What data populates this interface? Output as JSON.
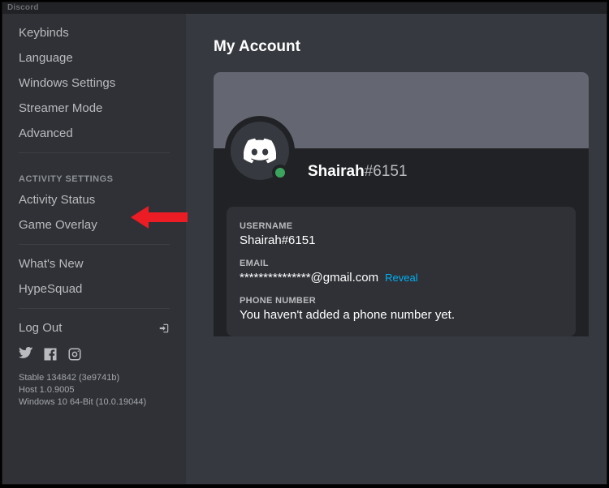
{
  "app": {
    "title": "Discord"
  },
  "sidebar": {
    "items": [
      {
        "label": "Keybinds"
      },
      {
        "label": "Language"
      },
      {
        "label": "Windows Settings"
      },
      {
        "label": "Streamer Mode"
      },
      {
        "label": "Advanced"
      }
    ],
    "activity_header": "ACTIVITY SETTINGS",
    "activity_items": [
      {
        "label": "Activity Status"
      },
      {
        "label": "Game Overlay"
      }
    ],
    "misc_items": [
      {
        "label": "What's New"
      },
      {
        "label": "HypeSquad"
      }
    ],
    "logout_label": "Log Out"
  },
  "build": {
    "line1": "Stable 134842 (3e9741b)",
    "line2": "Host 1.0.9005",
    "line3": "Windows 10 64-Bit (10.0.19044)"
  },
  "page": {
    "title": "My Account"
  },
  "profile": {
    "name": "Shairah",
    "discriminator": "#6151"
  },
  "fields": {
    "username_label": "USERNAME",
    "username_value": "Shairah#6151",
    "email_label": "EMAIL",
    "email_value": "***************@gmail.com",
    "email_reveal": "Reveal",
    "phone_label": "PHONE NUMBER",
    "phone_value": "You haven't added a phone number yet."
  }
}
